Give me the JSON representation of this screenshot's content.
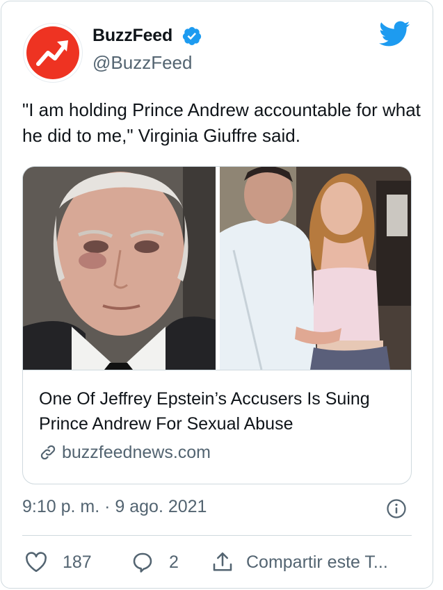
{
  "author": {
    "display_name": "BuzzFeed",
    "handle": "@BuzzFeed",
    "verified": true,
    "avatar_color": "#ee3322"
  },
  "tweet": {
    "text": "\"I am holding Prince Andrew accountable for what he did to me,\" Virginia Giuffre said.",
    "timestamp": "9:10 p. m. · 9 ago. 2021"
  },
  "link_card": {
    "title": "One Of Jeffrey Epstein’s Accusers Is Suing Prince Andrew For Sexual Abuse",
    "domain": "buzzfeednews.com"
  },
  "actions": {
    "like_count": "187",
    "reply_count": "2",
    "share_label": "Compartir este T..."
  },
  "icons": {
    "brand": "twitter-bird-icon",
    "verified": "verified-badge-icon",
    "info": "info-icon",
    "link": "link-icon",
    "like": "heart-icon",
    "reply": "reply-icon",
    "share": "share-icon"
  },
  "colors": {
    "twitter_blue": "#1d9bf0",
    "secondary_text": "#536471",
    "border": "#cfd9de"
  }
}
